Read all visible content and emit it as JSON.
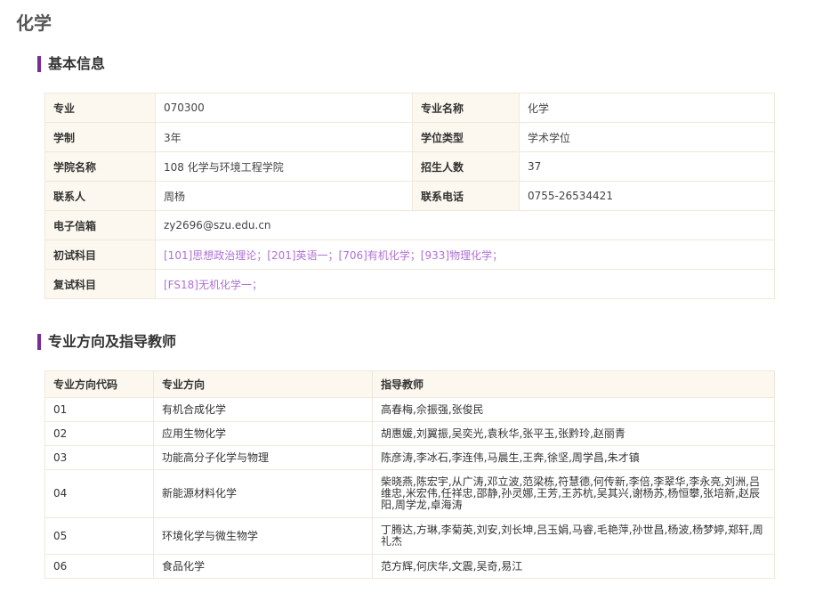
{
  "page": {
    "title": "化学"
  },
  "basic_info": {
    "heading": "基本信息",
    "rows": [
      [
        {
          "label": "专业",
          "value": "070300"
        },
        {
          "label": "专业名称",
          "value": "化学"
        }
      ],
      [
        {
          "label": "学制",
          "value": "3年"
        },
        {
          "label": "学位类型",
          "value": "学术学位"
        }
      ],
      [
        {
          "label": "学院名称",
          "value": "108 化学与环境工程学院"
        },
        {
          "label": "招生人数",
          "value": "37"
        }
      ],
      [
        {
          "label": "联系人",
          "value": "周杨"
        },
        {
          "label": "联系电话",
          "value": "0755-26534421"
        }
      ]
    ],
    "email": {
      "label": "电子信箱",
      "value": "zy2696@szu.edu.cn"
    },
    "preliminary": {
      "label": "初试科目",
      "value": "[101]思想政治理论；[201]英语一；[706]有机化学；[933]物理化学；"
    },
    "retest": {
      "label": "复试科目",
      "value": "[FS18]无机化学一；"
    },
    "highlight_color": "#b071d4",
    "accent_color": "#7b2a9a"
  },
  "directions": {
    "heading": "专业方向及指导教师",
    "headers": [
      "专业方向代码",
      "专业方向",
      "指导教师"
    ],
    "rows": [
      {
        "code": "01",
        "name": "有机合成化学",
        "teachers": "高春梅,佘振强,张俊民"
      },
      {
        "code": "02",
        "name": "应用生物化学",
        "teachers": "胡惠媛,刘翼振,吴奕光,袁秋华,张平玉,张黔玲,赵丽青"
      },
      {
        "code": "03",
        "name": "功能高分子化学与物理",
        "teachers": "陈彦涛,李冰石,李连伟,马晨生,王奔,徐坚,周学昌,朱才镇"
      },
      {
        "code": "04",
        "name": "新能源材料化学",
        "teachers": "柴晓燕,陈宏宇,从广涛,邓立波,范梁栋,符慧德,何传新,李倍,李翠华,李永亮,刘洲,吕维忠,米宏伟,任祥忠,邵静,孙灵娜,王芳,王苏杭,吴其兴,谢杨苏,杨恒攀,张培新,赵辰阳,周学龙,卓海涛"
      },
      {
        "code": "05",
        "name": "环境化学与微生物学",
        "teachers": "丁腾达,方琳,李菊英,刘安,刘长坤,吕玉娟,马睿,毛艳萍,孙世昌,杨波,杨梦婷,郑轩,周礼杰"
      },
      {
        "code": "06",
        "name": "食品化学",
        "teachers": "范方辉,何庆华,文震,吴奇,易江"
      }
    ]
  }
}
